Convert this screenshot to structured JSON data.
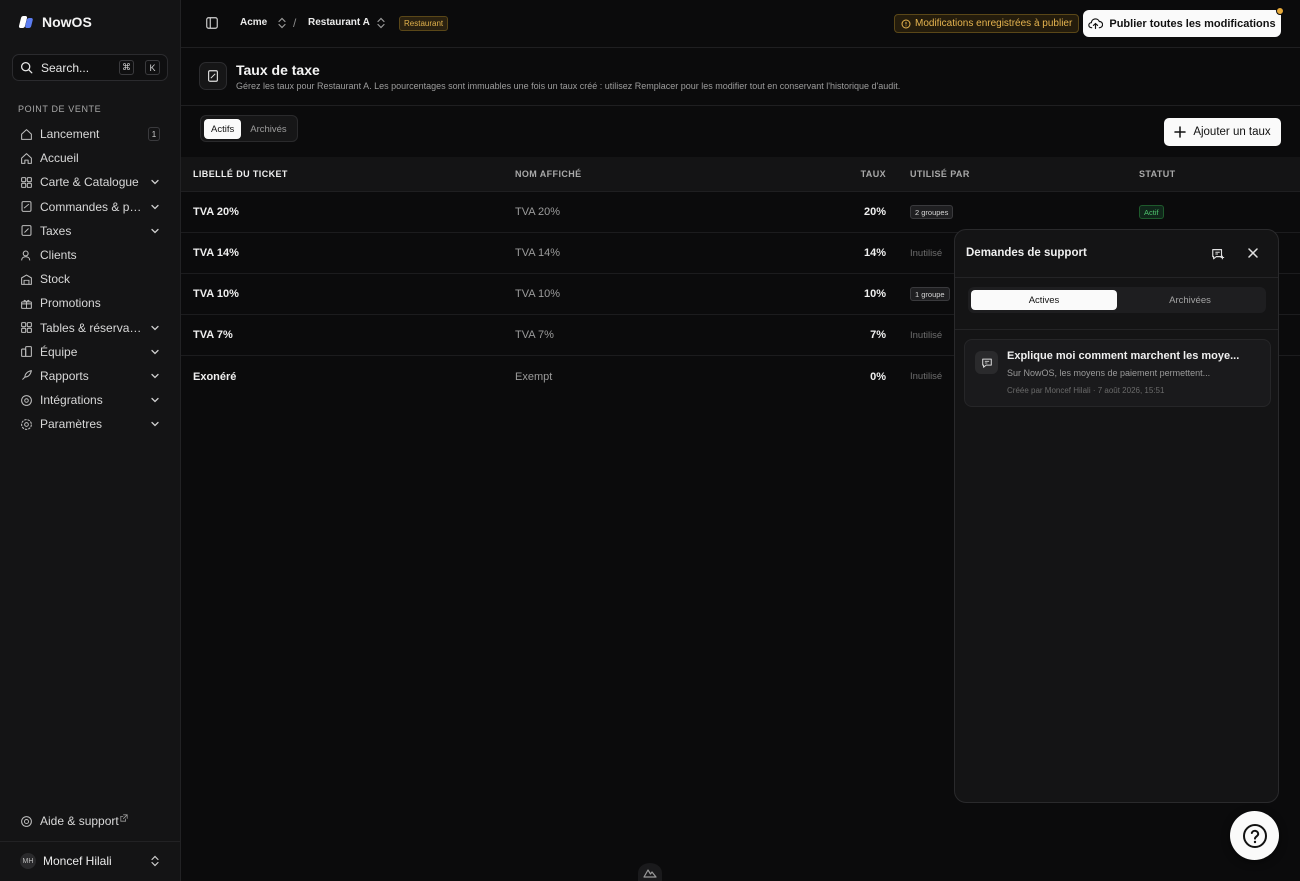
{
  "app": {
    "name": "NowOS"
  },
  "sidebar": {
    "search": {
      "label": "Search...",
      "shortcut_cmd": "⌘",
      "shortcut_key": "K"
    },
    "section_title": "POINT DE VENTE",
    "items": [
      {
        "label": "Lancement",
        "icon": "home-icon",
        "badge": "1"
      },
      {
        "label": "Accueil",
        "icon": "house-icon"
      },
      {
        "label": "Carte & Catalogue",
        "icon": "grid-icon",
        "expandable": true
      },
      {
        "label": "Commandes & paiements",
        "icon": "orders-icon",
        "expandable": true
      },
      {
        "label": "Taxes",
        "icon": "receipt-icon",
        "expandable": true
      },
      {
        "label": "Clients",
        "icon": "user-icon"
      },
      {
        "label": "Stock",
        "icon": "warehouse-icon"
      },
      {
        "label": "Promotions",
        "icon": "gift-icon"
      },
      {
        "label": "Tables & réservations",
        "icon": "tables-icon",
        "expandable": true
      },
      {
        "label": "Équipe",
        "icon": "team-icon",
        "expandable": true
      },
      {
        "label": "Rapports",
        "icon": "rocket-icon",
        "expandable": true
      },
      {
        "label": "Intégrations",
        "icon": "integrations-icon",
        "expandable": true
      },
      {
        "label": "Paramètres",
        "icon": "settings-icon",
        "expandable": true
      }
    ],
    "help": "Aide & support",
    "user": {
      "initials": "MH",
      "name": "Moncef Hilali"
    }
  },
  "topbar": {
    "org": "Acme",
    "separator": "/",
    "venue": "Restaurant A",
    "venue_tag": "Restaurant",
    "pending": "Modifications enregistrées à publier",
    "publish": "Publier toutes les modifications"
  },
  "page": {
    "title": "Taux de taxe",
    "subtitle": "Gérez les taux pour Restaurant A. Les pourcentages sont immuables une fois un taux créé : utilisez Remplacer pour les modifier tout en conservant l'historique d'audit.",
    "tabs": [
      {
        "label": "Actifs",
        "active": true
      },
      {
        "label": "Archivés",
        "active": false
      }
    ],
    "add_button": "Ajouter un taux"
  },
  "table": {
    "headers": {
      "label": "LIBELLÉ DU TICKET",
      "name": "NOM AFFICHÉ",
      "rate": "TAUX",
      "used": "UTILISÉ PAR",
      "status": "STATUT"
    },
    "rows": [
      {
        "label": "TVA 20%",
        "name": "TVA 20%",
        "rate": "20%",
        "used": "2 groupes",
        "used_kind": "pill",
        "status": "Actif"
      },
      {
        "label": "TVA 14%",
        "name": "TVA 14%",
        "rate": "14%",
        "used": "Inutilisé",
        "used_kind": "muted"
      },
      {
        "label": "TVA 10%",
        "name": "TVA 10%",
        "rate": "10%",
        "used": "1 groupe",
        "used_kind": "pill"
      },
      {
        "label": "TVA 7%",
        "name": "TVA 7%",
        "rate": "7%",
        "used": "Inutilisé",
        "used_kind": "muted"
      },
      {
        "label": "Exonéré",
        "name": "Exempt",
        "rate": "0%",
        "used": "Inutilisé",
        "used_kind": "muted"
      }
    ]
  },
  "support_panel": {
    "title": "Demandes de support",
    "tabs": [
      {
        "label": "Actives",
        "active": true
      },
      {
        "label": "Archivées",
        "active": false
      }
    ],
    "tickets": [
      {
        "title": "Explique moi comment marchent les moye...",
        "preview": "Sur NowOS, les moyens de paiement permettent...",
        "meta": "Créée par Moncef Hilali · 7 août 2026, 15:51"
      }
    ]
  },
  "colors": {
    "accent_warning": "#e6b44f",
    "status_active": "#4ec26c",
    "background": "#0b0b0c"
  }
}
